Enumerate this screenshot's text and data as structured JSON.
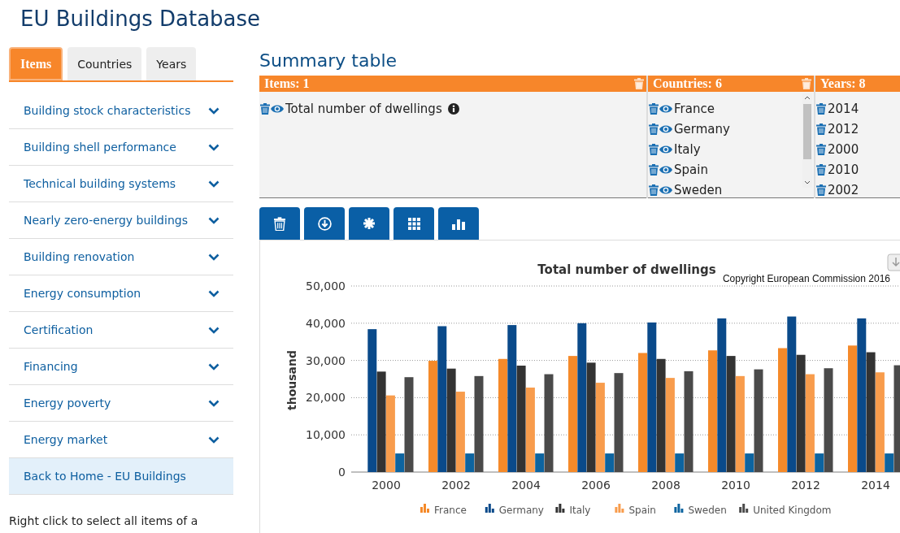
{
  "page_title": "EU Buildings Database",
  "sidebar": {
    "tabs": [
      {
        "label": "Items",
        "selected": true
      },
      {
        "label": "Countries",
        "selected": false
      },
      {
        "label": "Years",
        "selected": false
      }
    ],
    "items": [
      {
        "label": "Building stock characteristics",
        "kind": "category"
      },
      {
        "label": "Building shell performance",
        "kind": "category"
      },
      {
        "label": "Technical building systems",
        "kind": "category"
      },
      {
        "label": "Nearly zero-energy buildings",
        "kind": "category"
      },
      {
        "label": "Building renovation",
        "kind": "category"
      },
      {
        "label": "Energy consumption",
        "kind": "category"
      },
      {
        "label": "Certification",
        "kind": "category"
      },
      {
        "label": "Financing",
        "kind": "category"
      },
      {
        "label": "Energy poverty",
        "kind": "category"
      },
      {
        "label": "Energy market",
        "kind": "category"
      },
      {
        "label": "Back to Home - EU Buildings",
        "kind": "link"
      }
    ],
    "note": "Right click to select all items of a"
  },
  "summary": {
    "title": "Summary table",
    "columns": [
      {
        "header": "Items: 1",
        "kind": "items",
        "header_trash": true,
        "entries": [
          {
            "label": "Total number of dwellings",
            "info": true
          }
        ]
      },
      {
        "header": "Countries: 6",
        "kind": "countries",
        "header_trash": true,
        "entries": [
          {
            "label": "France",
            "info": false
          },
          {
            "label": "Germany",
            "info": false
          },
          {
            "label": "Italy",
            "info": false
          },
          {
            "label": "Spain",
            "info": false
          },
          {
            "label": "Sweden",
            "info": false
          }
        ]
      },
      {
        "header": "Years: 8",
        "kind": "years",
        "entries": [
          {
            "label": "2014",
            "info": false
          },
          {
            "label": "2012",
            "info": false
          },
          {
            "label": "2000",
            "info": false
          },
          {
            "label": "2010",
            "info": false
          },
          {
            "label": "2002",
            "info": false
          }
        ]
      }
    ]
  },
  "toolbar": [
    {
      "kind": "delete"
    },
    {
      "kind": "download"
    },
    {
      "kind": "asterisk"
    },
    {
      "kind": "grid"
    },
    {
      "kind": "chart"
    }
  ],
  "chart": {
    "copyright": "Copyright European Commission 2016",
    "chart_data": {
      "type": "bar",
      "title": "Total number of dwellings",
      "ylabel": "thousand",
      "categories": [
        "2000",
        "2002",
        "2004",
        "2006",
        "2008",
        "2010",
        "2012",
        "2014"
      ],
      "ylim": [
        0,
        50000
      ],
      "grid": true,
      "legend": "bottom",
      "yticks": [
        {
          "value": 0,
          "label": "0"
        },
        {
          "value": 10000,
          "label": "10,000"
        },
        {
          "value": 20000,
          "label": "20,000"
        },
        {
          "value": 30000,
          "label": "30,000"
        },
        {
          "value": 40000,
          "label": "40,000"
        },
        {
          "value": 50000,
          "label": "50,000"
        }
      ],
      "series": [
        {
          "name": "France",
          "color": "#f58a2a",
          "values": [
            null,
            29900,
            30400,
            31200,
            32000,
            32700,
            33300,
            34000
          ]
        },
        {
          "name": "Germany",
          "color": "#0a4a8a",
          "values": [
            38400,
            39200,
            39500,
            40000,
            40200,
            41300,
            41800,
            41300
          ]
        },
        {
          "name": "Italy",
          "color": "#333333",
          "values": [
            27000,
            27800,
            28600,
            29400,
            30400,
            31200,
            31500,
            32200
          ]
        },
        {
          "name": "Spain",
          "color": "#f89c4c",
          "values": [
            20600,
            21600,
            22700,
            24000,
            25300,
            25800,
            26300,
            26800
          ]
        },
        {
          "name": "Sweden",
          "color": "#0d64a0",
          "values": [
            5000,
            5000,
            5000,
            5000,
            5000,
            5000,
            5000,
            5000
          ]
        },
        {
          "name": "United Kingdom",
          "color": "#4a4a4a",
          "values": [
            25500,
            25800,
            26300,
            26600,
            27100,
            27600,
            27900,
            28700
          ]
        }
      ]
    }
  }
}
